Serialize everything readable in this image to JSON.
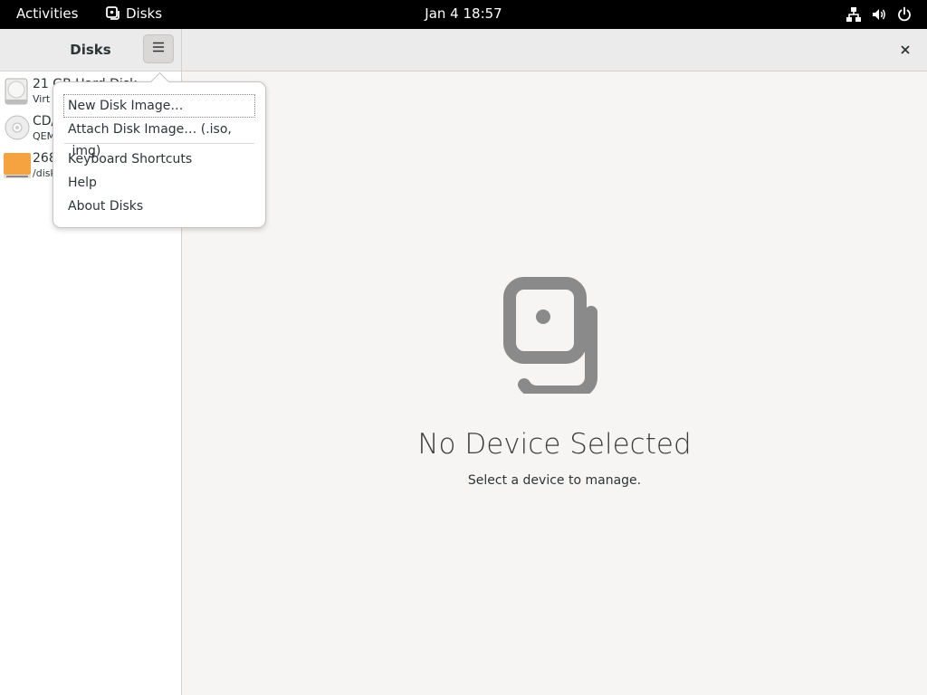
{
  "topbar": {
    "activities": "Activities",
    "app_name": "Disks",
    "clock": "Jan 4  18:57",
    "tray_icons": [
      "network-icon",
      "volume-icon",
      "power-icon"
    ]
  },
  "header": {
    "title": "Disks",
    "menu_icon": "hamburger-menu-icon",
    "close_icon": "close-icon"
  },
  "sidebar": {
    "items": [
      {
        "name": "21 GB Hard Disk",
        "sub": "Virt",
        "icon": "hard-disk-icon"
      },
      {
        "name": "CD/",
        "sub": "QEM",
        "icon": "optical-disc-icon"
      },
      {
        "name": "268",
        "sub": "/disk",
        "icon": "loop-device-icon"
      }
    ]
  },
  "menu": {
    "items": [
      {
        "label": "New Disk Image…",
        "focused": true
      },
      {
        "label": "Attach Disk Image… (.iso, .img)"
      },
      {
        "label": "Keyboard Shortcuts"
      },
      {
        "label": "Help"
      },
      {
        "label": "About Disks"
      }
    ]
  },
  "main": {
    "empty_title": "No Device Selected",
    "empty_subtitle": "Select a device to manage."
  },
  "colors": {
    "topbar": "#000000",
    "window_bg": "#f6f5f4",
    "sidebar_bg": "#ffffff",
    "empty_icon": "#8a8a8a",
    "loop_device_orange": "#f5a340"
  }
}
